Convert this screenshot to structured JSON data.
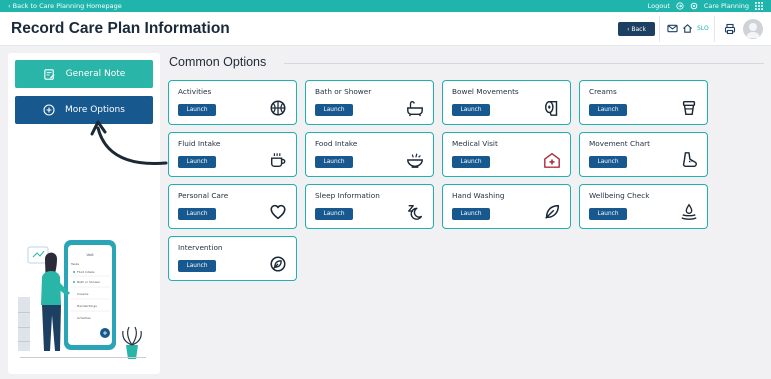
{
  "topbar": {
    "back_link": "‹ Back to Care Planning Homepage",
    "logout": "Logout",
    "app_name": "Care Planning",
    "bg_color": "#1fb5ad"
  },
  "header": {
    "title": "Record Care Plan Information",
    "back_button": "‹ Back",
    "home_label": "SLO"
  },
  "sidebar": {
    "general_note": "General Note",
    "more_options": "More Options",
    "illustration": {
      "phone_title": "Unit",
      "phone_header": "Tasks",
      "phone_items": [
        "Fluid Intake",
        "Bath or Shower",
        "Creams",
        "Handwritings",
        "Activities"
      ]
    }
  },
  "section": {
    "title": "Common Options"
  },
  "cards": [
    {
      "title": "Activities",
      "launch": "Launch",
      "icon": "basketball-icon"
    },
    {
      "title": "Bath or Shower",
      "launch": "Launch",
      "icon": "bathtub-icon"
    },
    {
      "title": "Bowel Movements",
      "launch": "Launch",
      "icon": "toilet-paper-icon"
    },
    {
      "title": "Creams",
      "launch": "Launch",
      "icon": "cream-pot-icon"
    },
    {
      "title": "Fluid Intake",
      "launch": "Launch",
      "icon": "mug-icon"
    },
    {
      "title": "Food Intake",
      "launch": "Launch",
      "icon": "bowl-icon"
    },
    {
      "title": "Medical Visit",
      "launch": "Launch",
      "icon": "medical-house-icon"
    },
    {
      "title": "Movement Chart",
      "launch": "Launch",
      "icon": "foot-icon"
    },
    {
      "title": "Personal Care",
      "launch": "Launch",
      "icon": "heart-icon"
    },
    {
      "title": "Sleep Information",
      "launch": "Launch",
      "icon": "sleep-icon"
    },
    {
      "title": "Hand Washing",
      "launch": "Launch",
      "icon": "leaf-icon"
    },
    {
      "title": "Wellbeing Check",
      "launch": "Launch",
      "icon": "water-drop-icon"
    },
    {
      "title": "Intervention",
      "launch": "Launch",
      "icon": "leaf-icon"
    }
  ],
  "colors": {
    "accent_teal": "#2ab5a9",
    "accent_blue": "#17588f",
    "medical_red": "#b03040"
  }
}
